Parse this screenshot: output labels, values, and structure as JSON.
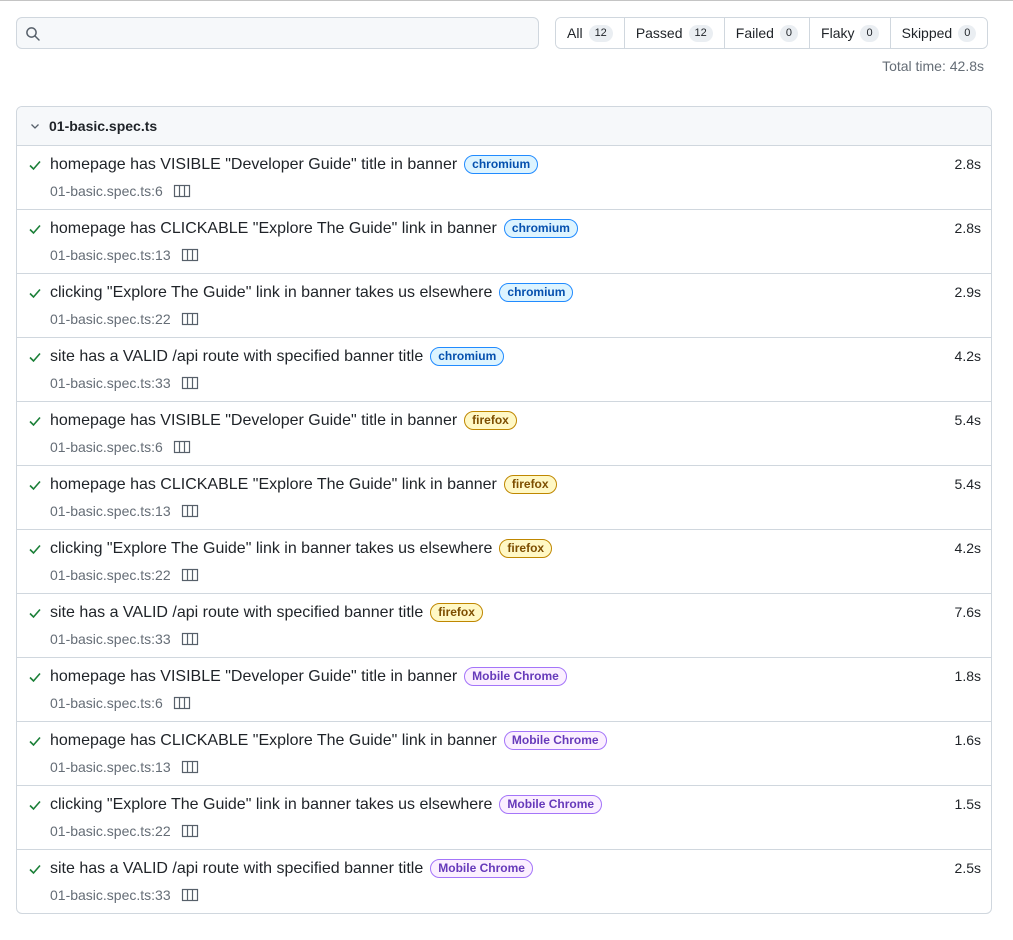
{
  "search": {
    "placeholder": "",
    "value": "",
    "icon": "search-icon"
  },
  "filters": [
    {
      "label": "All",
      "count": "12"
    },
    {
      "label": "Passed",
      "count": "12"
    },
    {
      "label": "Failed",
      "count": "0"
    },
    {
      "label": "Flaky",
      "count": "0"
    },
    {
      "label": "Skipped",
      "count": "0"
    }
  ],
  "total_time": "Total time: 42.8s",
  "file": {
    "name": "01-basic.spec.ts",
    "expanded": true,
    "tests": [
      {
        "title": "homepage has VISIBLE \"Developer Guide\" title in banner",
        "project": "chromium",
        "project_kind": "chromium",
        "location": "01-basic.spec.ts:6",
        "duration": "2.8s",
        "status": "passed"
      },
      {
        "title": "homepage has CLICKABLE \"Explore The Guide\" link in banner",
        "project": "chromium",
        "project_kind": "chromium",
        "location": "01-basic.spec.ts:13",
        "duration": "2.8s",
        "status": "passed"
      },
      {
        "title": "clicking \"Explore The Guide\" link in banner takes us elsewhere",
        "project": "chromium",
        "project_kind": "chromium",
        "location": "01-basic.spec.ts:22",
        "duration": "2.9s",
        "status": "passed"
      },
      {
        "title": "site has a VALID /api route with specified banner title",
        "project": "chromium",
        "project_kind": "chromium",
        "location": "01-basic.spec.ts:33",
        "duration": "4.2s",
        "status": "passed"
      },
      {
        "title": "homepage has VISIBLE \"Developer Guide\" title in banner",
        "project": "firefox",
        "project_kind": "firefox",
        "location": "01-basic.spec.ts:6",
        "duration": "5.4s",
        "status": "passed"
      },
      {
        "title": "homepage has CLICKABLE \"Explore The Guide\" link in banner",
        "project": "firefox",
        "project_kind": "firefox",
        "location": "01-basic.spec.ts:13",
        "duration": "5.4s",
        "status": "passed"
      },
      {
        "title": "clicking \"Explore The Guide\" link in banner takes us elsewhere",
        "project": "firefox",
        "project_kind": "firefox",
        "location": "01-basic.spec.ts:22",
        "duration": "4.2s",
        "status": "passed"
      },
      {
        "title": "site has a VALID /api route with specified banner title",
        "project": "firefox",
        "project_kind": "firefox",
        "location": "01-basic.spec.ts:33",
        "duration": "7.6s",
        "status": "passed"
      },
      {
        "title": "homepage has VISIBLE \"Developer Guide\" title in banner",
        "project": "Mobile Chrome",
        "project_kind": "mobile",
        "location": "01-basic.spec.ts:6",
        "duration": "1.8s",
        "status": "passed"
      },
      {
        "title": "homepage has CLICKABLE \"Explore The Guide\" link in banner",
        "project": "Mobile Chrome",
        "project_kind": "mobile",
        "location": "01-basic.spec.ts:13",
        "duration": "1.6s",
        "status": "passed"
      },
      {
        "title": "clicking \"Explore The Guide\" link in banner takes us elsewhere",
        "project": "Mobile Chrome",
        "project_kind": "mobile",
        "location": "01-basic.spec.ts:22",
        "duration": "1.5s",
        "status": "passed"
      },
      {
        "title": "site has a VALID /api route with specified banner title",
        "project": "Mobile Chrome",
        "project_kind": "mobile",
        "location": "01-basic.spec.ts:33",
        "duration": "2.5s",
        "status": "passed"
      }
    ]
  },
  "colors": {
    "passed": "#1a7f37",
    "chromium_badge": "#0550ae",
    "firefox_badge": "#7d4e00",
    "mobile_badge": "#6639ba"
  }
}
